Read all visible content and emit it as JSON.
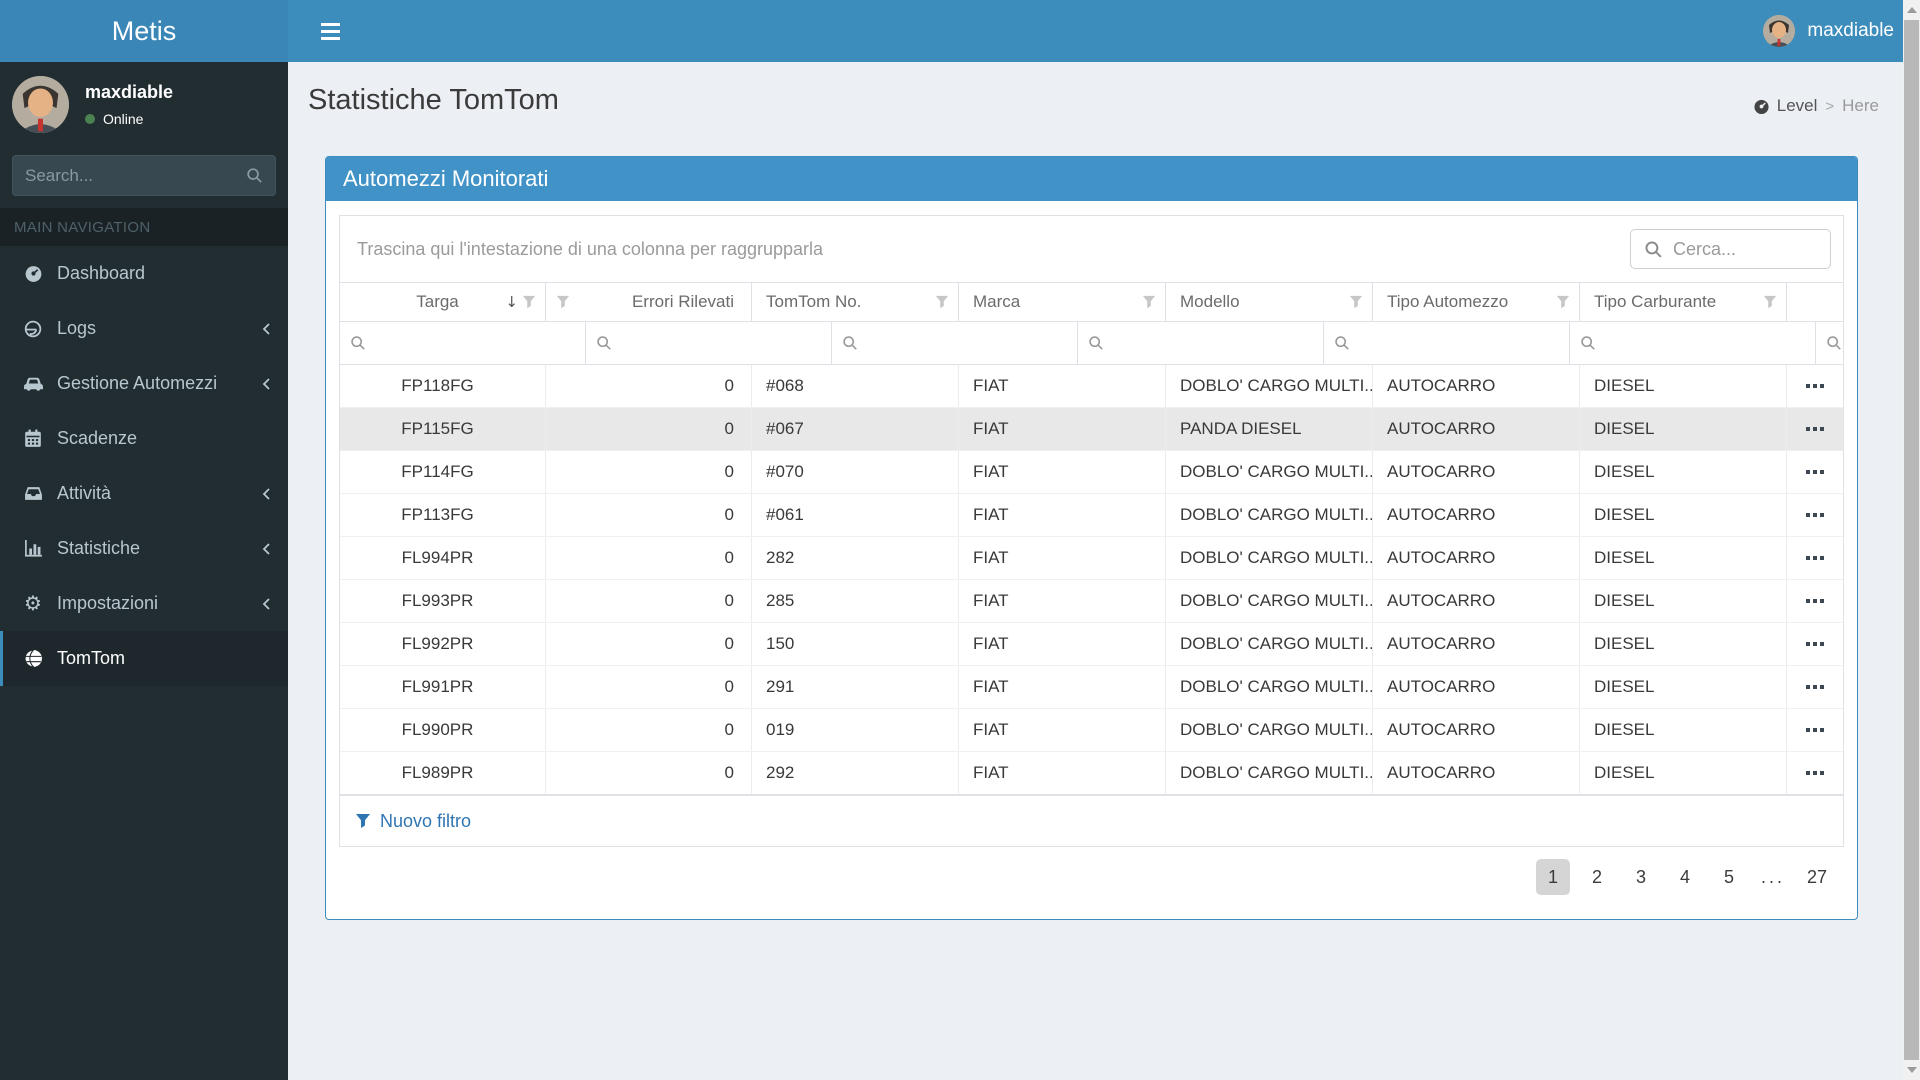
{
  "navbar": {
    "brand": "Metis",
    "user": "maxdiable"
  },
  "sidebar": {
    "user": {
      "name": "maxdiable",
      "status": "Online"
    },
    "search_placeholder": "Search...",
    "section_label": "MAIN NAVIGATION",
    "items": [
      {
        "label": "Dashboard",
        "icon": "dashboard-icon",
        "has_submenu": false,
        "active": false
      },
      {
        "label": "Logs",
        "icon": "logs-icon",
        "has_submenu": true,
        "active": false
      },
      {
        "label": "Gestione Automezzi",
        "icon": "car-icon",
        "has_submenu": true,
        "active": false
      },
      {
        "label": "Scadenze",
        "icon": "calendar-icon",
        "has_submenu": false,
        "active": false
      },
      {
        "label": "Attività",
        "icon": "inbox-icon",
        "has_submenu": true,
        "active": false
      },
      {
        "label": "Statistiche",
        "icon": "bar-chart-icon",
        "has_submenu": true,
        "active": false
      },
      {
        "label": "Impostazioni",
        "icon": "gear-icon",
        "has_submenu": true,
        "active": false
      },
      {
        "label": "TomTom",
        "icon": "globe-icon",
        "has_submenu": false,
        "active": true
      }
    ]
  },
  "content": {
    "page_title": "Statistiche TomTom",
    "breadcrumb": {
      "level": "Level",
      "sep": ">",
      "here": "Here"
    },
    "panel": {
      "title": "Automezzi Monitorati",
      "group_hint": "Trascina qui l'intestazione di una colonna per raggrupparla",
      "search_placeholder": "Cerca...",
      "grid": {
        "columns": [
          {
            "label": "Targa",
            "align": "center",
            "sorted": "desc",
            "filter_icon": "right"
          },
          {
            "label": "Errori Rilevati",
            "align": "right",
            "filter_icon": "left"
          },
          {
            "label": "TomTom No.",
            "align": "left",
            "filter_icon": "right"
          },
          {
            "label": "Marca",
            "align": "left",
            "filter_icon": "right"
          },
          {
            "label": "Modello",
            "align": "left",
            "filter_icon": "right"
          },
          {
            "label": "Tipo Automezzo",
            "align": "left",
            "filter_icon": "right"
          },
          {
            "label": "Tipo Carburante",
            "align": "left",
            "filter_icon": "right"
          }
        ],
        "rows": [
          [
            "FP118FG",
            "0",
            "#068",
            "FIAT",
            "DOBLO' CARGO MULTI...",
            "AUTOCARRO",
            "DIESEL"
          ],
          [
            "FP115FG",
            "0",
            "#067",
            "FIAT",
            "PANDA DIESEL",
            "AUTOCARRO",
            "DIESEL"
          ],
          [
            "FP114FG",
            "0",
            "#070",
            "FIAT",
            "DOBLO' CARGO MULTI...",
            "AUTOCARRO",
            "DIESEL"
          ],
          [
            "FP113FG",
            "0",
            "#061",
            "FIAT",
            "DOBLO' CARGO MULTI...",
            "AUTOCARRO",
            "DIESEL"
          ],
          [
            "FL994PR",
            "0",
            "282",
            "FIAT",
            "DOBLO' CARGO MULTI...",
            "AUTOCARRO",
            "DIESEL"
          ],
          [
            "FL993PR",
            "0",
            "285",
            "FIAT",
            "DOBLO' CARGO MULTI...",
            "AUTOCARRO",
            "DIESEL"
          ],
          [
            "FL992PR",
            "0",
            "150",
            "FIAT",
            "DOBLO' CARGO MULTI...",
            "AUTOCARRO",
            "DIESEL"
          ],
          [
            "FL991PR",
            "0",
            "291",
            "FIAT",
            "DOBLO' CARGO MULTI...",
            "AUTOCARRO",
            "DIESEL"
          ],
          [
            "FL990PR",
            "0",
            "019",
            "FIAT",
            "DOBLO' CARGO MULTI...",
            "AUTOCARRO",
            "DIESEL"
          ],
          [
            "FL989PR",
            "0",
            "292",
            "FIAT",
            "DOBLO' CARGO MULTI...",
            "AUTOCARRO",
            "DIESEL"
          ]
        ],
        "highlighted_row": 1
      },
      "footer_link": "Nuovo filtro",
      "pager": {
        "pages": [
          "1",
          "2",
          "3",
          "4",
          "5",
          "...",
          "27"
        ],
        "active": "1"
      }
    }
  },
  "colors": {
    "navbar": "#3c8dbc",
    "panel_header": "#4193c7",
    "sidebar": "#222d32",
    "sidebar_active_border": "#3c8dbc",
    "link_blue": "#2e75b2",
    "online_green": "#4b8252",
    "highlight_row": "#e8e8e8"
  }
}
